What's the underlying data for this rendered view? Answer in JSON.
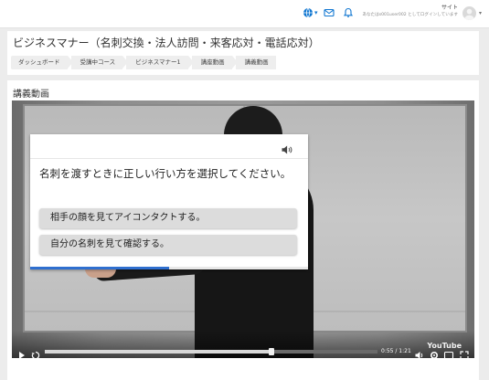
{
  "topbar": {
    "icons": [
      "globe-icon",
      "mail-icon",
      "bell-icon"
    ],
    "user_name": "サイト",
    "user_status": "あなたはs001user002 としてログインしています",
    "accent": "#1177d1"
  },
  "header": {
    "title": "ビジネスマナー（名刺交換・法人訪問・来客応対・電話応対）",
    "breadcrumb": [
      "ダッシュボード",
      "受講中コース",
      "ビジネスマナー1",
      "講座動画",
      "講義動画"
    ]
  },
  "main": {
    "section_title": "講義動画"
  },
  "quiz": {
    "question": "名刺を渡すときに正しい行い方を選択してください。",
    "options": [
      "相手の顔を見てアイコンタクトする。",
      "自分の名刺を見て確認する。"
    ],
    "progress_fraction": 0.5,
    "accent": "#2f6fcf"
  },
  "player": {
    "time": "0:55 / 1:21",
    "played_fraction": 0.68,
    "watermark": "YouTube"
  }
}
